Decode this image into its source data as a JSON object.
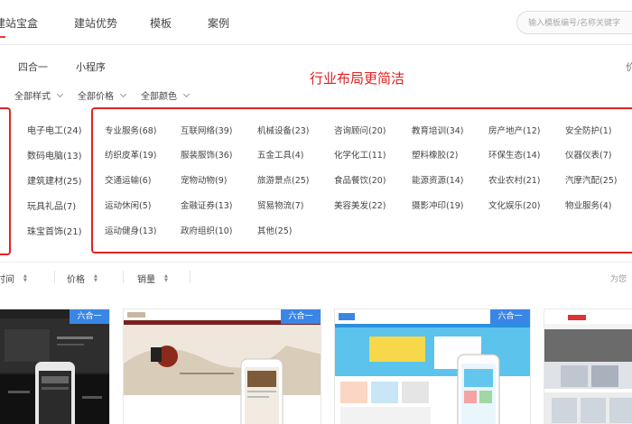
{
  "nav": {
    "items": [
      "建站宝盒",
      "建站优势",
      "模板",
      "案例"
    ],
    "search_placeholder": "输入模板编号/名称关键字"
  },
  "tabs": {
    "items": [
      "四合一",
      "小程序"
    ],
    "right": "价"
  },
  "annotation": "行业布局更简洁",
  "filters": [
    "全部样式",
    "全部价格",
    "全部颜色"
  ],
  "side_categories": [
    "电子电工(24)",
    "数码电脑(13)",
    "建筑建材(25)",
    "玩具礼品(7)",
    "珠宝首饰(21)"
  ],
  "categories": [
    [
      "专业服务(68)",
      "互联网络(39)",
      "机械设备(23)",
      "咨询顾问(20)",
      "教育培训(34)",
      "房产地产(12)",
      "安全防护(1)"
    ],
    [
      "纺织皮革(19)",
      "服装服饰(36)",
      "五金工具(4)",
      "化学化工(11)",
      "塑料橡胶(2)",
      "环保生态(14)",
      "仪器仪表(7)"
    ],
    [
      "交通运输(6)",
      "宠物动物(9)",
      "旅游景点(25)",
      "食品餐饮(20)",
      "能源资源(14)",
      "农业农村(21)",
      "汽摩汽配(25)"
    ],
    [
      "运动休闲(5)",
      "金融证券(13)",
      "贸易物流(7)",
      "美容美发(22)",
      "摄影冲印(19)",
      "文化娱乐(20)",
      "物业服务(4)"
    ],
    [
      "运动健身(13)",
      "政府组织(10)",
      "其他(25)"
    ]
  ],
  "sort": {
    "items": [
      "时间",
      "价格",
      "销量"
    ],
    "right": "为您"
  },
  "cards": {
    "badge": "六合一"
  },
  "colors": {
    "accent_red": "#e32222",
    "badge_blue": "#3a86e6"
  }
}
